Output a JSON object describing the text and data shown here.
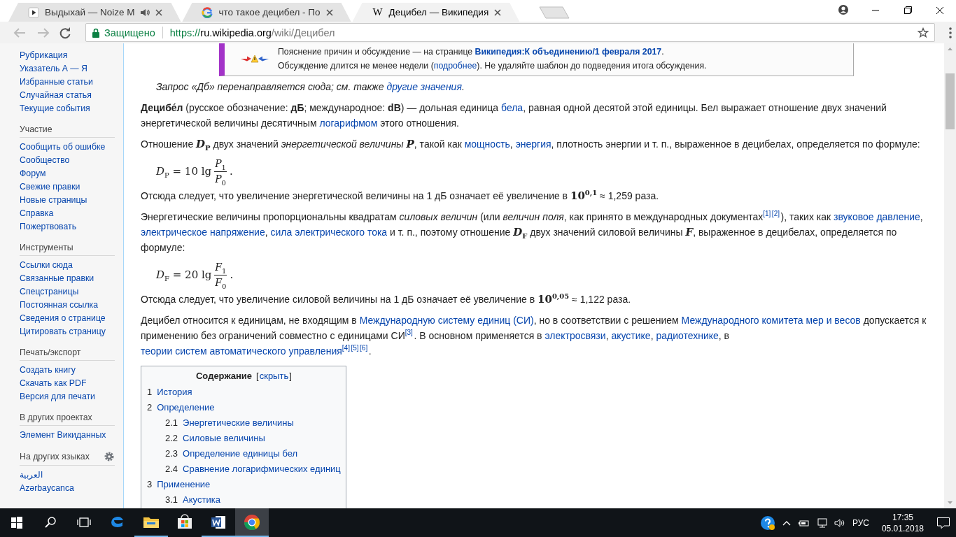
{
  "browser": {
    "tabs": [
      {
        "title": "Выдыхай — Noize M",
        "kind": "play",
        "audio": true,
        "selected": false
      },
      {
        "title": "что такое децибел - По",
        "kind": "google",
        "audio": false,
        "selected": false
      },
      {
        "title": "Децибел — Википедия",
        "kind": "wiki",
        "icon_text": "W",
        "audio": false,
        "selected": true
      }
    ],
    "secure_label": "Защищено",
    "url": {
      "scheme": "https://",
      "host": "ru.wikipedia.org",
      "path": "/wiki/Децибел"
    }
  },
  "sidebar": {
    "groups": [
      {
        "items": [
          "Рубрикация",
          "Указатель А — Я",
          "Избранные статьи",
          "Случайная статья",
          "Текущие события"
        ]
      },
      {
        "heading": "Участие",
        "items": [
          "Сообщить об ошибке",
          "Сообщество",
          "Форум",
          "Свежие правки",
          "Новые страницы",
          "Справка",
          "Пожертвовать"
        ]
      },
      {
        "heading": "Инструменты",
        "items": [
          "Ссылки сюда",
          "Связанные правки",
          "Спецстраницы",
          "Постоянная ссылка",
          "Сведения о странице",
          "Цитировать страницу"
        ]
      },
      {
        "heading": "Печать/экспорт",
        "items": [
          "Создать книгу",
          "Скачать как PDF",
          "Версия для печати"
        ]
      },
      {
        "heading": "В других проектах",
        "items": [
          "Элемент Викиданных"
        ]
      },
      {
        "heading": "На других языках",
        "settings": true,
        "items": [
          "العربية",
          "Azərbaycanca"
        ]
      }
    ]
  },
  "notice": {
    "lines": [
      [
        {
          "kind": "text",
          "t": "Пояснение причин и обсуждение — на странице "
        },
        {
          "kind": "strong_link",
          "t": "Википедия:К объединению/1 февраля 2017"
        },
        {
          "kind": "text",
          "t": "."
        }
      ],
      [
        {
          "kind": "text",
          "t": "Обсуждение длится не менее недели ("
        },
        {
          "kind": "link",
          "t": "подробнее"
        },
        {
          "kind": "text",
          "t": "). Не удаляйте шаблон до подведения итога обсуждения."
        }
      ]
    ]
  },
  "hatnote": [
    {
      "kind": "text",
      "t": "Запрос «Дб» перенаправляется сюда; см. также "
    },
    {
      "kind": "link",
      "t": "другие значения"
    },
    {
      "kind": "text",
      "t": "."
    }
  ],
  "content": [
    {
      "kind": "paragraph",
      "segments": [
        {
          "kind": "text",
          "t": "**Децибе́л** (русское обозначение: **дБ**; международное: **dB**) — дольная единица "
        },
        {
          "kind": "link",
          "t": "бела"
        },
        {
          "kind": "text",
          "t": ", равная одной десятой этой единицы. Бел выражает отношение двух значений энергетической величины десятичным "
        },
        {
          "kind": "link",
          "t": "логарифмом"
        },
        {
          "kind": "text",
          "t": " этого отношения."
        }
      ]
    },
    {
      "kind": "paragraph",
      "segments": [
        {
          "kind": "text",
          "t": "Отношение "
        },
        {
          "kind": "math",
          "t": "*D*$_{P}$"
        },
        {
          "kind": "text",
          "t": " двух значений *энергетической величины* "
        },
        {
          "kind": "math",
          "t": "*P*"
        },
        {
          "kind": "text",
          "t": ", такой как "
        },
        {
          "kind": "link",
          "t": "мощность"
        },
        {
          "kind": "text",
          "t": ", "
        },
        {
          "kind": "link",
          "t": "энергия"
        },
        {
          "kind": "text",
          "t": ", плотность энергии и т. п., выраженное в децибелах, определяется по формуле:"
        }
      ]
    },
    {
      "kind": "formula",
      "lhs": "*D*$_{P}$ = 10 lg",
      "numerator": "*P*$_{1}$",
      "denominator": "*P*$_{0}$",
      "tail": "."
    },
    {
      "kind": "paragraph",
      "segments": [
        {
          "kind": "text",
          "t": "Отсюда следует, что увеличение энергетической величины на 1 дБ означает её увеличение в "
        },
        {
          "kind": "math",
          "t": "10$^{0,1}$"
        },
        {
          "kind": "text",
          "t": " ≈ 1,259 раза."
        }
      ]
    },
    {
      "kind": "paragraph",
      "segments": [
        {
          "kind": "text",
          "t": "Энергетические величины пропорциональны квадратам *силовых величин* (или *величин поля*, как принято в международных документах"
        },
        {
          "kind": "ref",
          "t": "[1]"
        },
        {
          "kind": "ref",
          "t": "[2]"
        },
        {
          "kind": "text",
          "t": "), таких как "
        },
        {
          "kind": "link",
          "t": "звуковое давление"
        },
        {
          "kind": "text",
          "t": ", "
        },
        {
          "kind": "link",
          "t": "электрическое напряжение"
        },
        {
          "kind": "text",
          "t": ", "
        },
        {
          "kind": "link",
          "t": "сила электрического тока"
        },
        {
          "kind": "text",
          "t": " и т. п., поэтому отношение "
        },
        {
          "kind": "math",
          "t": "*D*$_{F}$"
        },
        {
          "kind": "text",
          "t": " двух значений силовой величины "
        },
        {
          "kind": "math",
          "t": "*F*"
        },
        {
          "kind": "text",
          "t": ", выраженное в децибелах, определяется по формуле:"
        }
      ]
    },
    {
      "kind": "formula",
      "lhs": "*D*$_{F}$ = 20 lg",
      "numerator": "*F*$_{1}$",
      "denominator": "*F*$_{0}$",
      "tail": "."
    },
    {
      "kind": "paragraph",
      "segments": [
        {
          "kind": "text",
          "t": "Отсюда следует, что увеличение силовой величины на 1 дБ означает её увеличение в "
        },
        {
          "kind": "math",
          "t": "10$^{0,05}$"
        },
        {
          "kind": "text",
          "t": " ≈ 1,122 раза."
        }
      ]
    },
    {
      "kind": "paragraph",
      "segments": [
        {
          "kind": "text",
          "t": "Децибел относится к единицам, не входящим в "
        },
        {
          "kind": "link",
          "t": "Международную систему единиц (СИ)"
        },
        {
          "kind": "text",
          "t": ", но в соответствии с решением "
        },
        {
          "kind": "link",
          "t": "Международного комитета мер и весов"
        },
        {
          "kind": "text",
          "t": " допускается к применению без ограничений совместно с единицами СИ"
        },
        {
          "kind": "ref",
          "t": "[3]"
        },
        {
          "kind": "text",
          "t": ". В основном применяется в "
        },
        {
          "kind": "link",
          "t": "электросвязи"
        },
        {
          "kind": "text",
          "t": ", "
        },
        {
          "kind": "link",
          "t": "акустике"
        },
        {
          "kind": "text",
          "t": ", "
        },
        {
          "kind": "link",
          "t": "радиотехнике"
        },
        {
          "kind": "text",
          "t": ", в "
        },
        {
          "kind": "link",
          "t": "теории систем автоматического управления"
        },
        {
          "kind": "ref",
          "t": "[4]"
        },
        {
          "kind": "ref",
          "t": "[5]"
        },
        {
          "kind": "ref",
          "t": "[6]"
        },
        {
          "kind": "text",
          "t": "."
        }
      ]
    }
  ],
  "toc": {
    "title": "Содержание",
    "bracket_open": "[",
    "toggle": "скрыть",
    "bracket_close": "]",
    "items": [
      {
        "number": "1",
        "text": "История"
      },
      {
        "number": "2",
        "text": "Определение",
        "children": [
          {
            "number": "2.1",
            "text": "Энергетические величины"
          },
          {
            "number": "2.2",
            "text": "Силовые величины"
          },
          {
            "number": "2.3",
            "text": "Определение единицы бел"
          },
          {
            "number": "2.4",
            "text": "Сравнение логарифмических единиц"
          }
        ]
      },
      {
        "number": "3",
        "text": "Применение",
        "children": [
          {
            "number": "3.1",
            "text": "Акустика"
          }
        ]
      }
    ]
  },
  "taskbar": {
    "apps": [
      {
        "kind": "edge",
        "running": false,
        "active": false
      },
      {
        "kind": "folder",
        "running": true,
        "active": false
      },
      {
        "kind": "store",
        "running": false,
        "active": false
      },
      {
        "kind": "word",
        "running": true,
        "active": false
      },
      {
        "kind": "chrome",
        "running": true,
        "active": true
      }
    ],
    "language": "РУС",
    "time": "17:35",
    "date": "05.01.2018"
  }
}
